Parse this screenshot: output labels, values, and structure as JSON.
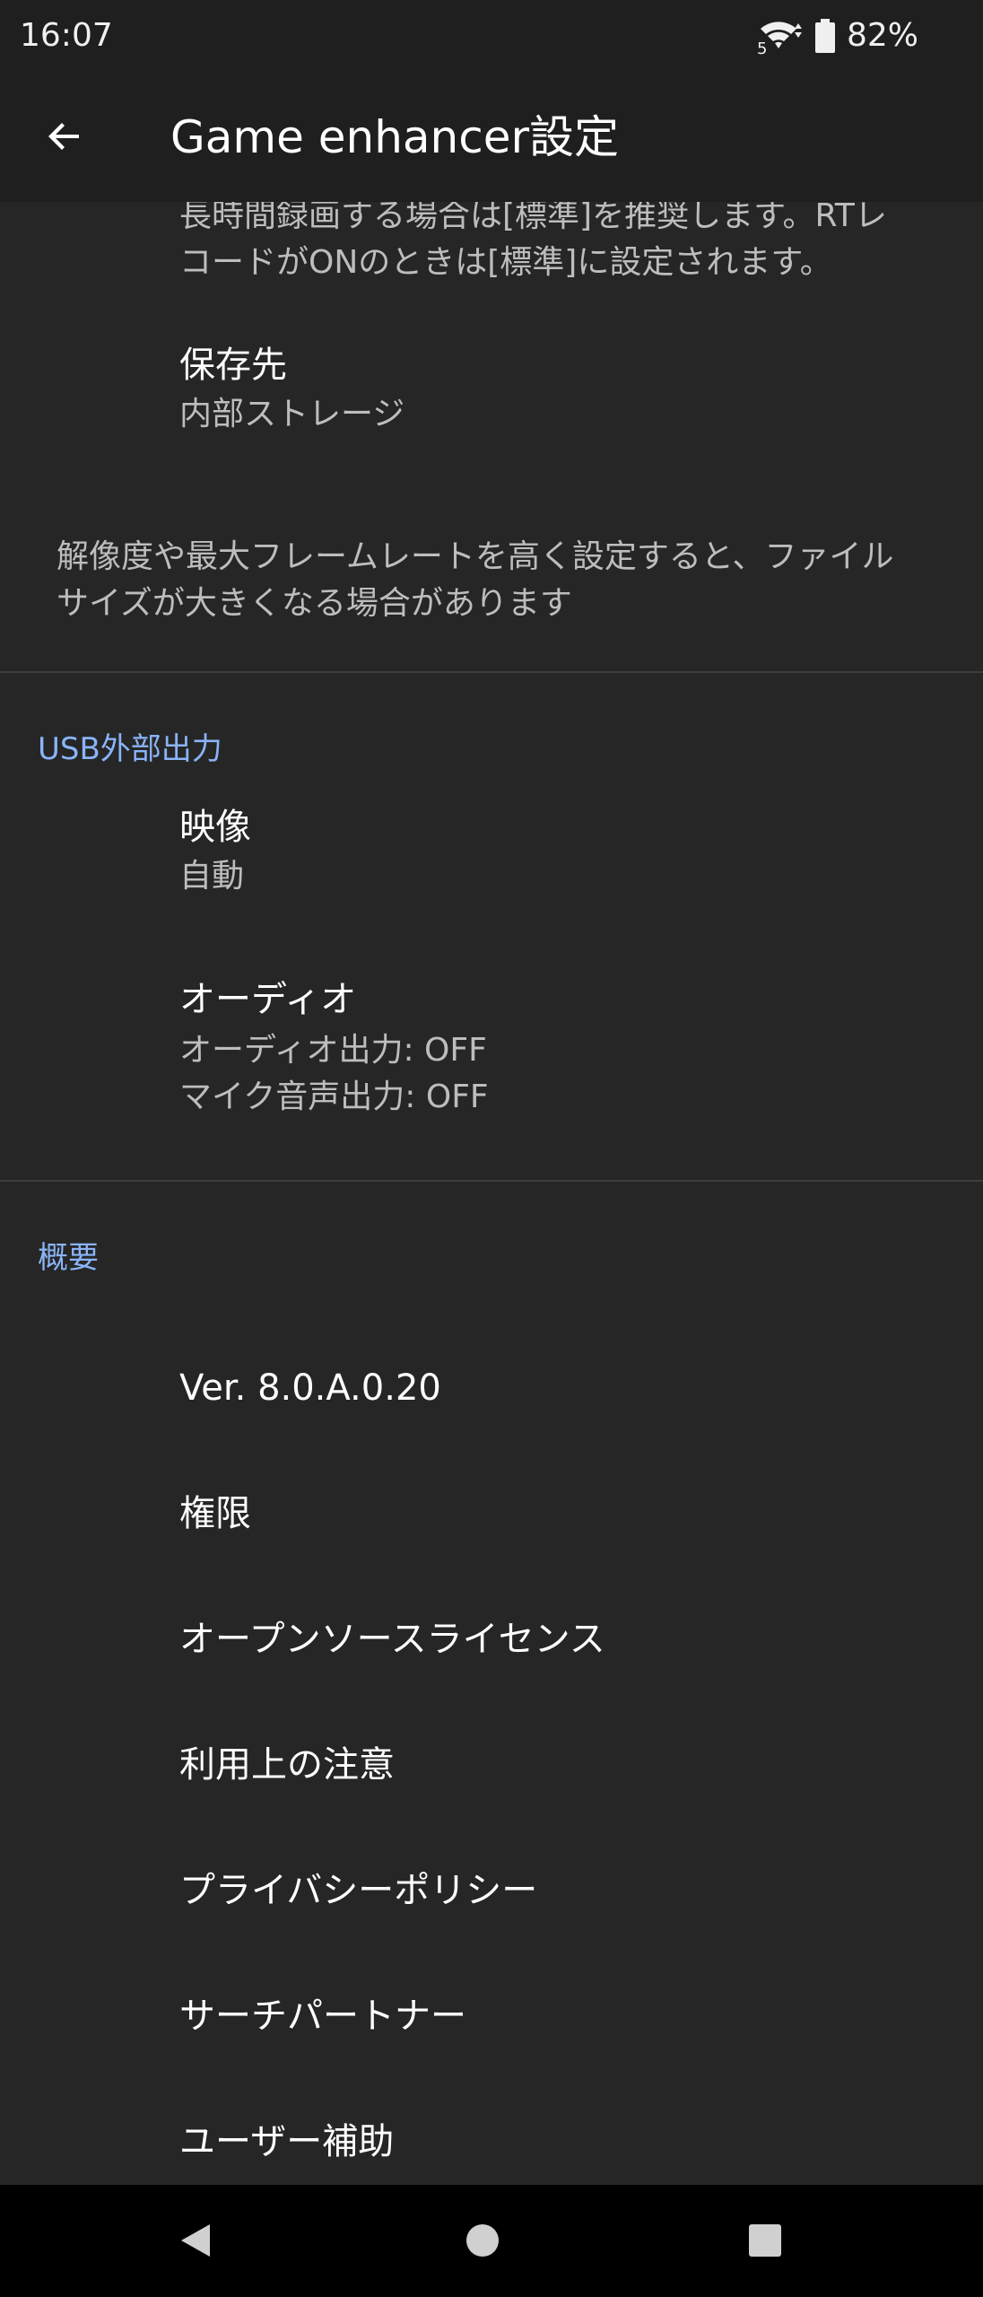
{
  "status_bar": {
    "time": "16:07",
    "network_label": "5",
    "battery_percent": "82%"
  },
  "app_bar": {
    "title": "Game enhancer設定",
    "back_icon": "arrow-back-icon"
  },
  "recording": {
    "truncated_summary_line1": "長時間録画する場合は[標準]を推奨します。RTレ",
    "truncated_summary_line2": "コードがONのときは[標準]に設定されます。",
    "save_location": {
      "title": "保存先",
      "value": "内部ストレージ"
    },
    "footer_line1": "解像度や最大フレームレートを高く設定すると、ファイル",
    "footer_line2": "サイズが大きくなる場合があります"
  },
  "usb_output": {
    "header": "USB外部出力",
    "video": {
      "title": "映像",
      "value": "自動"
    },
    "audio": {
      "title": "オーディオ",
      "line1": "オーディオ出力: OFF",
      "line2": "マイク音声出力: OFF"
    }
  },
  "about": {
    "header": "概要",
    "items": [
      "Ver. 8.0.A.0.20",
      "権限",
      "オープンソースライセンス",
      "利用上の注意",
      "プライバシーポリシー",
      "サーチパートナー",
      "ユーザー補助"
    ]
  },
  "nav_bar": {
    "back_icon": "nav-back-icon",
    "home_icon": "nav-home-icon",
    "recents_icon": "nav-recents-icon"
  },
  "colors": {
    "background": "#262626",
    "bars": "#1f1f1f",
    "accent": "#8ab4f8",
    "primary_text": "#ffffff",
    "secondary_text": "#bdbdbd"
  }
}
